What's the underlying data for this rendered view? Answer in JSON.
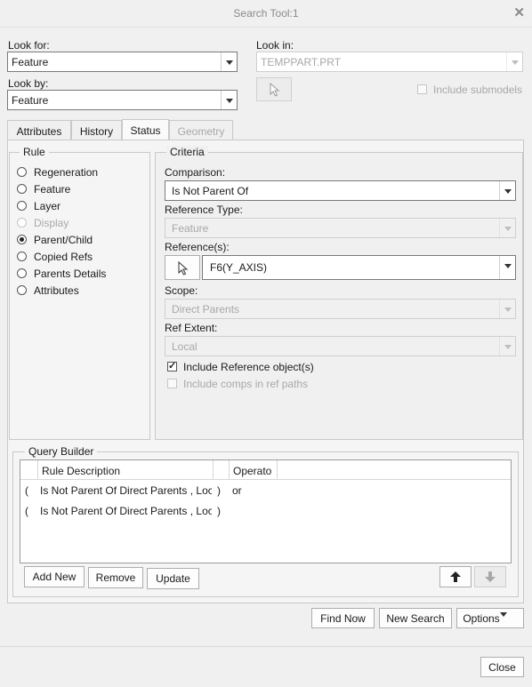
{
  "window": {
    "title": "Search Tool:1",
    "close_glyph": "✕"
  },
  "look_for": {
    "label": "Look for:",
    "value": "Feature"
  },
  "look_by": {
    "label": "Look by:",
    "value": "Feature"
  },
  "look_in": {
    "label": "Look in:",
    "value": "TEMPPART.PRT",
    "include_submodels": "Include submodels"
  },
  "tabs": [
    {
      "label": "Attributes",
      "state": "normal"
    },
    {
      "label": "History",
      "state": "normal"
    },
    {
      "label": "Status",
      "state": "active"
    },
    {
      "label": "Geometry",
      "state": "disabled"
    }
  ],
  "rule": {
    "title": "Rule",
    "options": [
      {
        "label": "Regeneration",
        "selected": false,
        "disabled": false
      },
      {
        "label": "Feature",
        "selected": false,
        "disabled": false
      },
      {
        "label": "Layer",
        "selected": false,
        "disabled": false
      },
      {
        "label": "Display",
        "selected": false,
        "disabled": true
      },
      {
        "label": "Parent/Child",
        "selected": true,
        "disabled": false
      },
      {
        "label": "Copied Refs",
        "selected": false,
        "disabled": false
      },
      {
        "label": "Parents Details",
        "selected": false,
        "disabled": false
      },
      {
        "label": "Attributes",
        "selected": false,
        "disabled": false
      }
    ]
  },
  "criteria": {
    "title": "Criteria",
    "comparison": {
      "label": "Comparison:",
      "value": "Is Not Parent Of"
    },
    "reference_type": {
      "label": "Reference Type:",
      "value": "Feature"
    },
    "references": {
      "label": "Reference(s):",
      "value": "F6(Y_AXIS)"
    },
    "scope": {
      "label": "Scope:",
      "value": "Direct Parents"
    },
    "ref_extent": {
      "label": "Ref Extent:",
      "value": "Local"
    },
    "include_reference_objects": {
      "label": "Include Reference object(s)",
      "checked": true
    },
    "include_comps": {
      "label": "Include comps in ref paths",
      "checked": false
    }
  },
  "query_builder": {
    "title": "Query Builder",
    "columns": [
      "Rule Description",
      "Operato"
    ],
    "rows": [
      {
        "open": "(",
        "description": "Is Not Parent Of Direct Parents , Loca",
        "close": ")",
        "operator": "or"
      },
      {
        "open": "(",
        "description": "Is Not Parent Of Direct Parents , Loca",
        "close": ")",
        "operator": ""
      }
    ],
    "buttons": {
      "add_new": "Add New",
      "remove": "Remove",
      "update": "Update"
    }
  },
  "actions": {
    "find_now": "Find Now",
    "new_search": "New Search",
    "options": "Options"
  },
  "footer": {
    "close": "Close"
  }
}
